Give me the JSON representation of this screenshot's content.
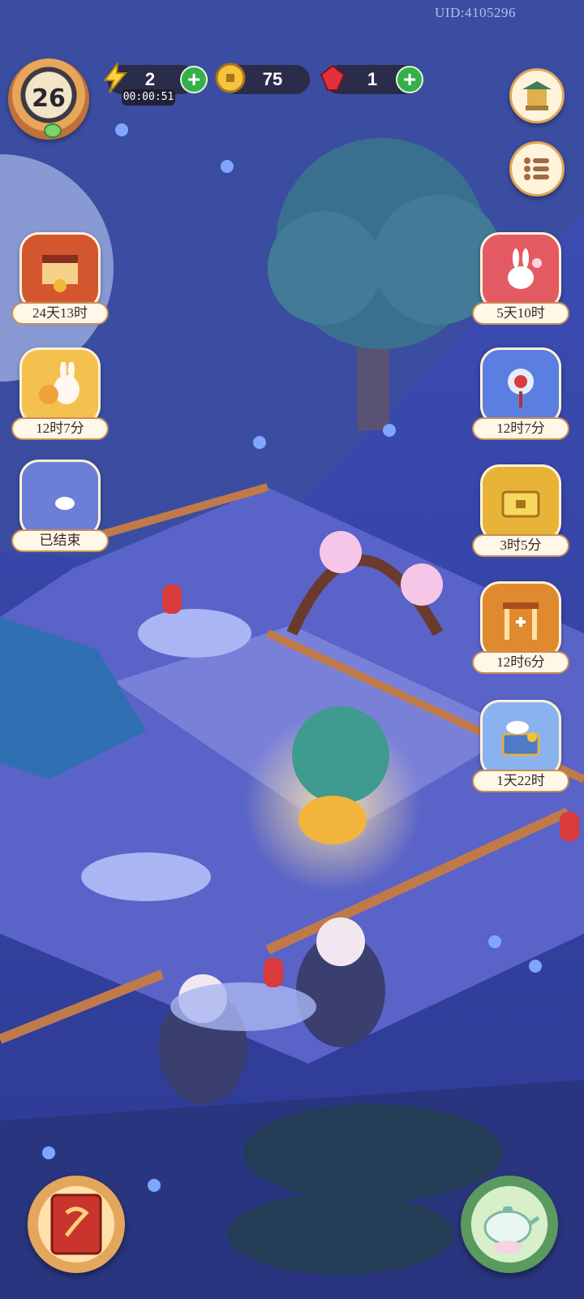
{
  "uid": "UID:4105296",
  "player": {
    "level": "26"
  },
  "resources": {
    "energy": {
      "value": "2",
      "timer": "00:00:51",
      "icon": "lightning-icon"
    },
    "coins": {
      "value": "75",
      "icon": "coin-icon"
    },
    "gems": {
      "value": "1",
      "icon": "ruby-icon"
    }
  },
  "right_buttons": [
    {
      "name": "shop-pavilion-button",
      "icon": "pavilion-icon"
    },
    {
      "name": "menu-button",
      "icon": "list-icon"
    }
  ],
  "left_events": [
    {
      "label": "24天13时",
      "icon": "scroll-gift-icon",
      "color": "#d4562e"
    },
    {
      "label": "12时7分",
      "icon": "rabbit-lantern-icon",
      "color": "#f4c04e"
    },
    {
      "label": "已结束",
      "icon": "moon-rabbit-icon",
      "color": "#6b7fd6"
    }
  ],
  "right_events": [
    {
      "label": "5天10时",
      "icon": "rabbit-blossom-icon",
      "color": "#e45a63"
    },
    {
      "label": "12时7分",
      "icon": "knot-charm-icon",
      "color": "#5a7fe0"
    },
    {
      "label": "3时5分",
      "icon": "golden-chest-icon",
      "color": "#e8b437"
    },
    {
      "label": "12时6分",
      "icon": "plus-one-gate-icon",
      "color": "#e08a2f"
    },
    {
      "label": "1天22时",
      "icon": "treasure-chest-icon",
      "color": "#8ab2ef"
    }
  ],
  "bottom_buttons": [
    {
      "name": "journal-book-button",
      "icon": "red-book-icon"
    },
    {
      "name": "teapot-button",
      "icon": "teapot-icon"
    }
  ]
}
